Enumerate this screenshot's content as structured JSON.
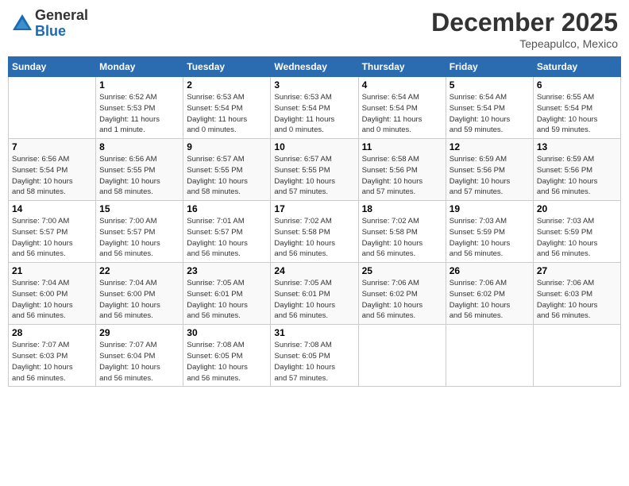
{
  "header": {
    "logo": {
      "general": "General",
      "blue": "Blue"
    },
    "month": "December 2025",
    "location": "Tepeapulco, Mexico"
  },
  "weekdays": [
    "Sunday",
    "Monday",
    "Tuesday",
    "Wednesday",
    "Thursday",
    "Friday",
    "Saturday"
  ],
  "weeks": [
    [
      {
        "day": "",
        "info": ""
      },
      {
        "day": "1",
        "info": "Sunrise: 6:52 AM\nSunset: 5:53 PM\nDaylight: 11 hours\nand 1 minute."
      },
      {
        "day": "2",
        "info": "Sunrise: 6:53 AM\nSunset: 5:54 PM\nDaylight: 11 hours\nand 0 minutes."
      },
      {
        "day": "3",
        "info": "Sunrise: 6:53 AM\nSunset: 5:54 PM\nDaylight: 11 hours\nand 0 minutes."
      },
      {
        "day": "4",
        "info": "Sunrise: 6:54 AM\nSunset: 5:54 PM\nDaylight: 11 hours\nand 0 minutes."
      },
      {
        "day": "5",
        "info": "Sunrise: 6:54 AM\nSunset: 5:54 PM\nDaylight: 10 hours\nand 59 minutes."
      },
      {
        "day": "6",
        "info": "Sunrise: 6:55 AM\nSunset: 5:54 PM\nDaylight: 10 hours\nand 59 minutes."
      }
    ],
    [
      {
        "day": "7",
        "info": "Sunrise: 6:56 AM\nSunset: 5:54 PM\nDaylight: 10 hours\nand 58 minutes."
      },
      {
        "day": "8",
        "info": "Sunrise: 6:56 AM\nSunset: 5:55 PM\nDaylight: 10 hours\nand 58 minutes."
      },
      {
        "day": "9",
        "info": "Sunrise: 6:57 AM\nSunset: 5:55 PM\nDaylight: 10 hours\nand 58 minutes."
      },
      {
        "day": "10",
        "info": "Sunrise: 6:57 AM\nSunset: 5:55 PM\nDaylight: 10 hours\nand 57 minutes."
      },
      {
        "day": "11",
        "info": "Sunrise: 6:58 AM\nSunset: 5:56 PM\nDaylight: 10 hours\nand 57 minutes."
      },
      {
        "day": "12",
        "info": "Sunrise: 6:59 AM\nSunset: 5:56 PM\nDaylight: 10 hours\nand 57 minutes."
      },
      {
        "day": "13",
        "info": "Sunrise: 6:59 AM\nSunset: 5:56 PM\nDaylight: 10 hours\nand 56 minutes."
      }
    ],
    [
      {
        "day": "14",
        "info": "Sunrise: 7:00 AM\nSunset: 5:57 PM\nDaylight: 10 hours\nand 56 minutes."
      },
      {
        "day": "15",
        "info": "Sunrise: 7:00 AM\nSunset: 5:57 PM\nDaylight: 10 hours\nand 56 minutes."
      },
      {
        "day": "16",
        "info": "Sunrise: 7:01 AM\nSunset: 5:57 PM\nDaylight: 10 hours\nand 56 minutes."
      },
      {
        "day": "17",
        "info": "Sunrise: 7:02 AM\nSunset: 5:58 PM\nDaylight: 10 hours\nand 56 minutes."
      },
      {
        "day": "18",
        "info": "Sunrise: 7:02 AM\nSunset: 5:58 PM\nDaylight: 10 hours\nand 56 minutes."
      },
      {
        "day": "19",
        "info": "Sunrise: 7:03 AM\nSunset: 5:59 PM\nDaylight: 10 hours\nand 56 minutes."
      },
      {
        "day": "20",
        "info": "Sunrise: 7:03 AM\nSunset: 5:59 PM\nDaylight: 10 hours\nand 56 minutes."
      }
    ],
    [
      {
        "day": "21",
        "info": "Sunrise: 7:04 AM\nSunset: 6:00 PM\nDaylight: 10 hours\nand 56 minutes."
      },
      {
        "day": "22",
        "info": "Sunrise: 7:04 AM\nSunset: 6:00 PM\nDaylight: 10 hours\nand 56 minutes."
      },
      {
        "day": "23",
        "info": "Sunrise: 7:05 AM\nSunset: 6:01 PM\nDaylight: 10 hours\nand 56 minutes."
      },
      {
        "day": "24",
        "info": "Sunrise: 7:05 AM\nSunset: 6:01 PM\nDaylight: 10 hours\nand 56 minutes."
      },
      {
        "day": "25",
        "info": "Sunrise: 7:06 AM\nSunset: 6:02 PM\nDaylight: 10 hours\nand 56 minutes."
      },
      {
        "day": "26",
        "info": "Sunrise: 7:06 AM\nSunset: 6:02 PM\nDaylight: 10 hours\nand 56 minutes."
      },
      {
        "day": "27",
        "info": "Sunrise: 7:06 AM\nSunset: 6:03 PM\nDaylight: 10 hours\nand 56 minutes."
      }
    ],
    [
      {
        "day": "28",
        "info": "Sunrise: 7:07 AM\nSunset: 6:03 PM\nDaylight: 10 hours\nand 56 minutes."
      },
      {
        "day": "29",
        "info": "Sunrise: 7:07 AM\nSunset: 6:04 PM\nDaylight: 10 hours\nand 56 minutes."
      },
      {
        "day": "30",
        "info": "Sunrise: 7:08 AM\nSunset: 6:05 PM\nDaylight: 10 hours\nand 56 minutes."
      },
      {
        "day": "31",
        "info": "Sunrise: 7:08 AM\nSunset: 6:05 PM\nDaylight: 10 hours\nand 57 minutes."
      },
      {
        "day": "",
        "info": ""
      },
      {
        "day": "",
        "info": ""
      },
      {
        "day": "",
        "info": ""
      }
    ]
  ]
}
